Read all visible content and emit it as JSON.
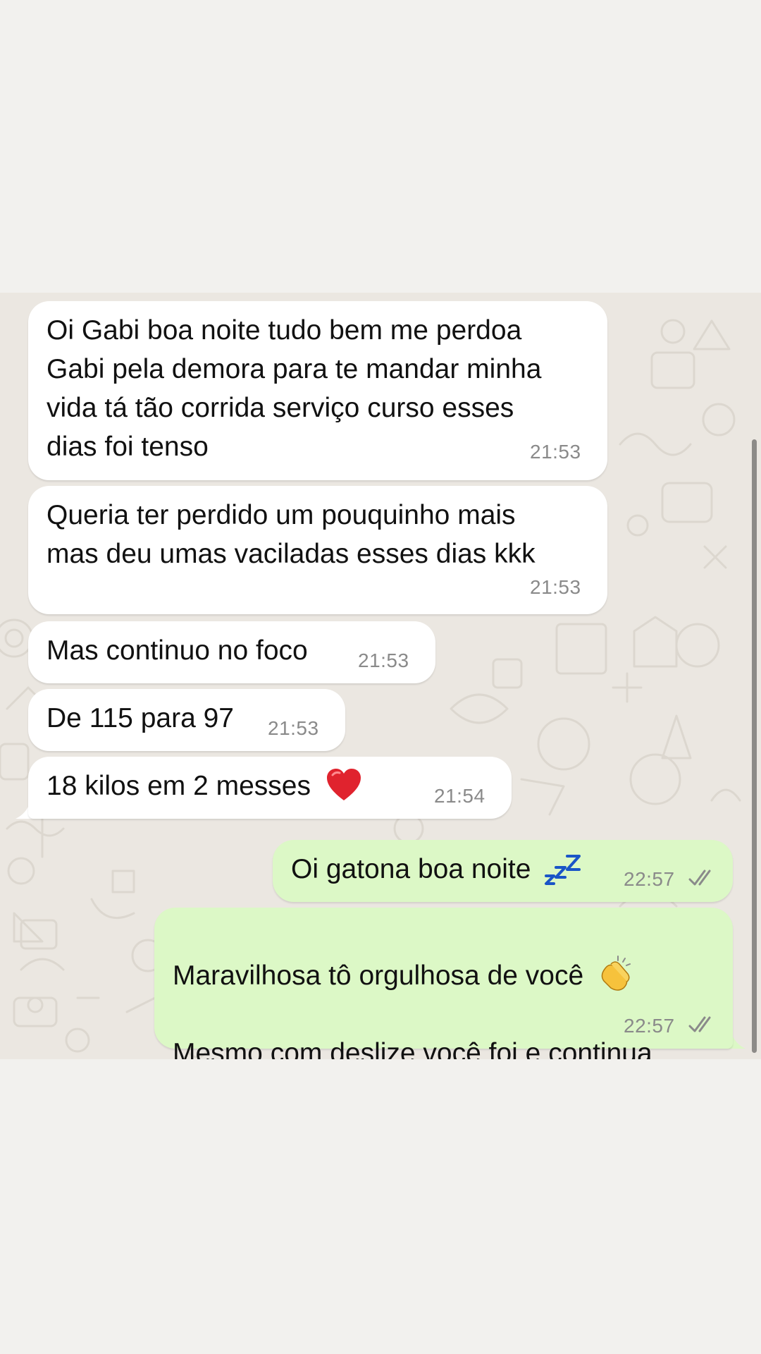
{
  "chat": {
    "messages": [
      {
        "direction": "incoming",
        "text": "Oi Gabi boa noite tudo bem me perdoa\nGabi pela demora para te mandar minha\nvida tá tão corrida serviço curso esses\ndias foi tenso",
        "time": "21:53"
      },
      {
        "direction": "incoming",
        "text": "Queria ter perdido um pouquinho mais\nmas deu umas vaciladas esses dias kkk",
        "time": "21:53"
      },
      {
        "direction": "incoming",
        "text": "Mas continuo no foco",
        "time": "21:53"
      },
      {
        "direction": "incoming",
        "text": "De 115 para 97",
        "time": "21:53"
      },
      {
        "direction": "incoming",
        "text": "18 kilos em 2 messes",
        "emoji": "red-heart",
        "time": "21:54"
      },
      {
        "direction": "outgoing",
        "text": "Oi gatona boa noite",
        "emoji": "zzz",
        "time": "22:57",
        "status": "read"
      },
      {
        "direction": "outgoing",
        "line1": "Maravilhosa tô orgulhosa de você",
        "emoji": "clapping-hands",
        "line2": "Mesmo com deslize você foi e continua\nótima",
        "time": "22:57",
        "status": "read"
      }
    ]
  },
  "colors": {
    "page_background": "#f2f1ee",
    "chat_background": "#ebe7e1",
    "incoming_bubble": "#ffffff",
    "outgoing_bubble": "#dcf8c6",
    "timestamp": "#8a8a8a",
    "heart": "#e0232e",
    "zzz": "#1a55c7",
    "clap": "#f6c23c"
  }
}
